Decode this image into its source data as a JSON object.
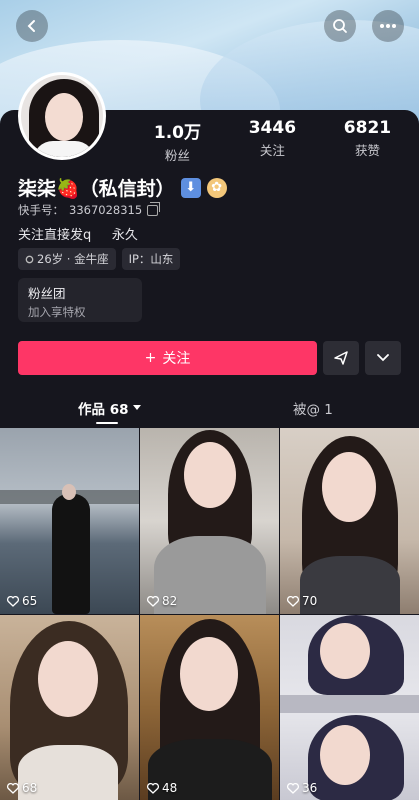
{
  "profile": {
    "name": "柒柒🍓（私信封）",
    "uid_label": "快手号：",
    "uid": "3367028315",
    "bio": "关注直接发q     永久",
    "tags": [
      {
        "text": "26岁 · 金牛座"
      },
      {
        "text": "IP：山东"
      }
    ],
    "stats": [
      {
        "value": "1.0万",
        "label": "粉丝"
      },
      {
        "value": "3446",
        "label": "关注"
      },
      {
        "value": "6821",
        "label": "获赞"
      }
    ],
    "fan_group": {
      "title": "粉丝团",
      "subtitle": "加入享特权"
    }
  },
  "actions": {
    "follow_label": "关注",
    "follow_plus": "+"
  },
  "tabs": {
    "works_label": "作品 68",
    "mention_label": "被@ 1"
  },
  "grid": [
    {
      "likes": "65"
    },
    {
      "likes": "82"
    },
    {
      "likes": "70"
    },
    {
      "likes": "68"
    },
    {
      "likes": "48"
    },
    {
      "likes": "36"
    }
  ],
  "colors": {
    "accent": "#fe3666",
    "background": "#16161e"
  },
  "icons": [
    "back-icon",
    "search-icon",
    "more-icon",
    "copy-icon",
    "location-icon",
    "share-icon",
    "chevron-down-icon",
    "heart-icon"
  ]
}
